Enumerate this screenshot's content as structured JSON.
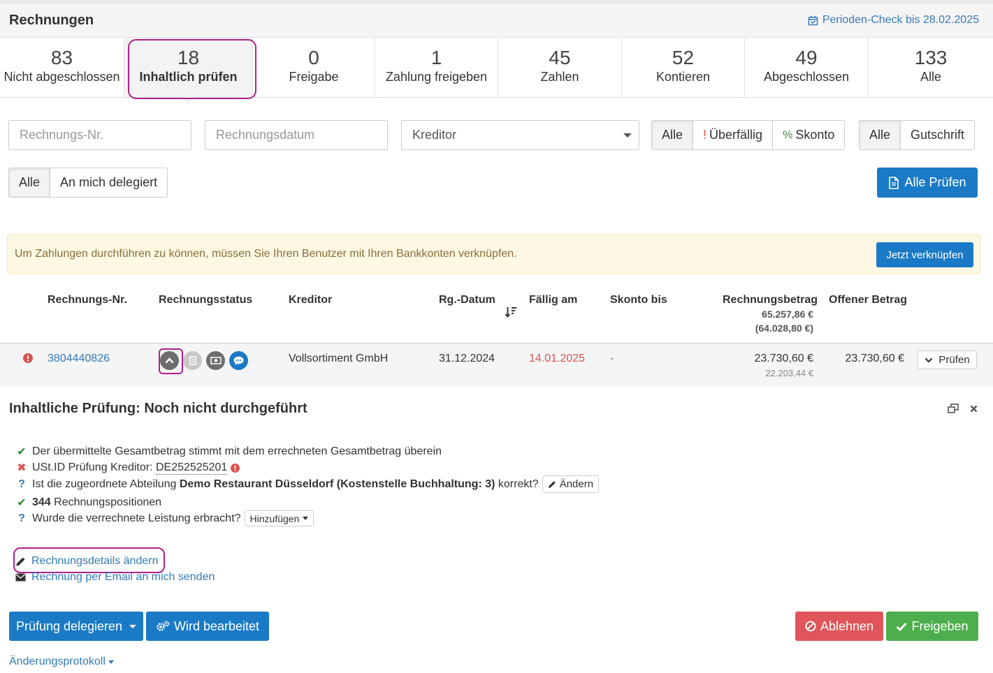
{
  "header": {
    "title": "Rechnungen",
    "period_check": "Perioden-Check bis 28.02.2025"
  },
  "tabs": [
    {
      "count": "83",
      "label": "Nicht abgeschlossen"
    },
    {
      "count": "18",
      "label": "Inhaltlich prüfen"
    },
    {
      "count": "0",
      "label": "Freigabe"
    },
    {
      "count": "1",
      "label": "Zahlung freigeben"
    },
    {
      "count": "45",
      "label": "Zahlen"
    },
    {
      "count": "52",
      "label": "Kontieren"
    },
    {
      "count": "49",
      "label": "Abgeschlossen"
    },
    {
      "count": "133",
      "label": "Alle"
    }
  ],
  "filters": {
    "invoice_no_placeholder": "Rechnungs-Nr.",
    "invoice_date_placeholder": "Rechnungsdatum",
    "creditor_value": "Kreditor",
    "due_group": {
      "all": "Alle",
      "overdue": "Überfällig",
      "overdue_mark": "!",
      "discount": "Skonto",
      "discount_mark": "%"
    },
    "type_group": {
      "all": "Alle",
      "credit": "Gutschrift"
    },
    "delegate_group": {
      "all": "Alle",
      "delegated": "An mich delegiert"
    },
    "check_all_label": "Alle Prüfen"
  },
  "alert": {
    "text": "Um Zahlungen durchführen zu können, müssen Sie Ihren Benutzer mit Ihren Bankkonten verknüpfen.",
    "button": "Jetzt verknüpfen"
  },
  "table": {
    "headers": {
      "invoice_no": "Rechnungs-Nr.",
      "status": "Rechnungsstatus",
      "creditor": "Kreditor",
      "date": "Rg.-Datum",
      "due": "Fällig am",
      "discount_until": "Skonto bis",
      "amount": "Rechnungsbetrag",
      "amount_total": "65.257,86 €",
      "amount_total_net": "(64.028,80 €)",
      "open_amount": "Offener Betrag"
    },
    "row": {
      "invoice_no": "3804440826",
      "creditor": "Vollsortiment GmbH",
      "date": "31.12.2024",
      "due": "14.01.2025",
      "discount_until": "-",
      "amount": "23.730,60 €",
      "amount_net": "22.203,44 €",
      "open_amount": "23.730,60 €",
      "action": "Prüfen"
    }
  },
  "detail": {
    "title": "Inhaltliche Prüfung: Noch nicht durchgeführt",
    "checks": {
      "c1": "Der übermittelte Gesamtbetrag stimmt mit dem errechneten Gesamtbetrag überein",
      "c2_prefix": "USt.ID Prüfung Kreditor:",
      "c2_value": "DE252525201",
      "c3_prefix": "Ist die zugeordnete Abteilung",
      "c3_bold": "Demo Restaurant Düsseldorf (Kostenstelle Buchhaltung: 3)",
      "c3_suffix": "korrekt?",
      "c3_button": "Ändern",
      "c4_bold": "344",
      "c4_text": "Rechnungspositionen",
      "c5_text": "Wurde die verrechnete Leistung erbracht?",
      "c5_button": "Hinzufügen"
    },
    "links": {
      "edit": "Rechnungsdetails ändern",
      "email": "Rechnung per Email an mich senden"
    },
    "buttons": {
      "delegate": "Prüfung delegieren",
      "in_progress": "Wird bearbeitet",
      "reject": "Ablehnen",
      "approve": "Freigeben"
    },
    "changelog": "Änderungsprotokoll"
  },
  "colors": {
    "primary": "#1a7ac6",
    "link": "#337ab7",
    "danger": "#e0555a",
    "success": "#4cae4c",
    "highlight": "#b0208a",
    "alert_bg": "#fcf8e3"
  }
}
